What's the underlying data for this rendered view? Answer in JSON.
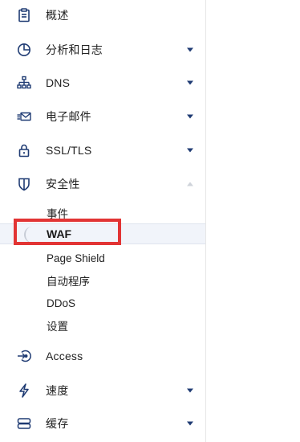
{
  "sidebar": {
    "items": [
      {
        "label": "概述",
        "icon": "clipboard-icon"
      },
      {
        "label": "分析和日志",
        "icon": "pie-chart-icon",
        "expand": "collapsed"
      },
      {
        "label": "DNS",
        "icon": "network-icon",
        "expand": "collapsed"
      },
      {
        "label": "电子邮件",
        "icon": "email-forward-icon",
        "expand": "collapsed"
      },
      {
        "label": "SSL/TLS",
        "icon": "lock-icon",
        "expand": "collapsed"
      },
      {
        "label": "安全性",
        "icon": "shield-icon",
        "expand": "expanded"
      },
      {
        "label": "Access",
        "icon": "access-login-icon"
      },
      {
        "label": "速度",
        "icon": "lightning-icon",
        "expand": "collapsed"
      },
      {
        "label": "缓存",
        "icon": "storage-icon",
        "expand": "collapsed"
      }
    ],
    "security_subitems": [
      {
        "label": "事件"
      },
      {
        "label": "WAF",
        "active": true
      },
      {
        "label": "Page Shield"
      },
      {
        "label": "自动程序"
      },
      {
        "label": "DDoS"
      },
      {
        "label": "设置"
      }
    ]
  },
  "colors": {
    "highlight_box": "#e23434",
    "icon": "#1f3b73",
    "active_bg": "#f1f4fa"
  }
}
